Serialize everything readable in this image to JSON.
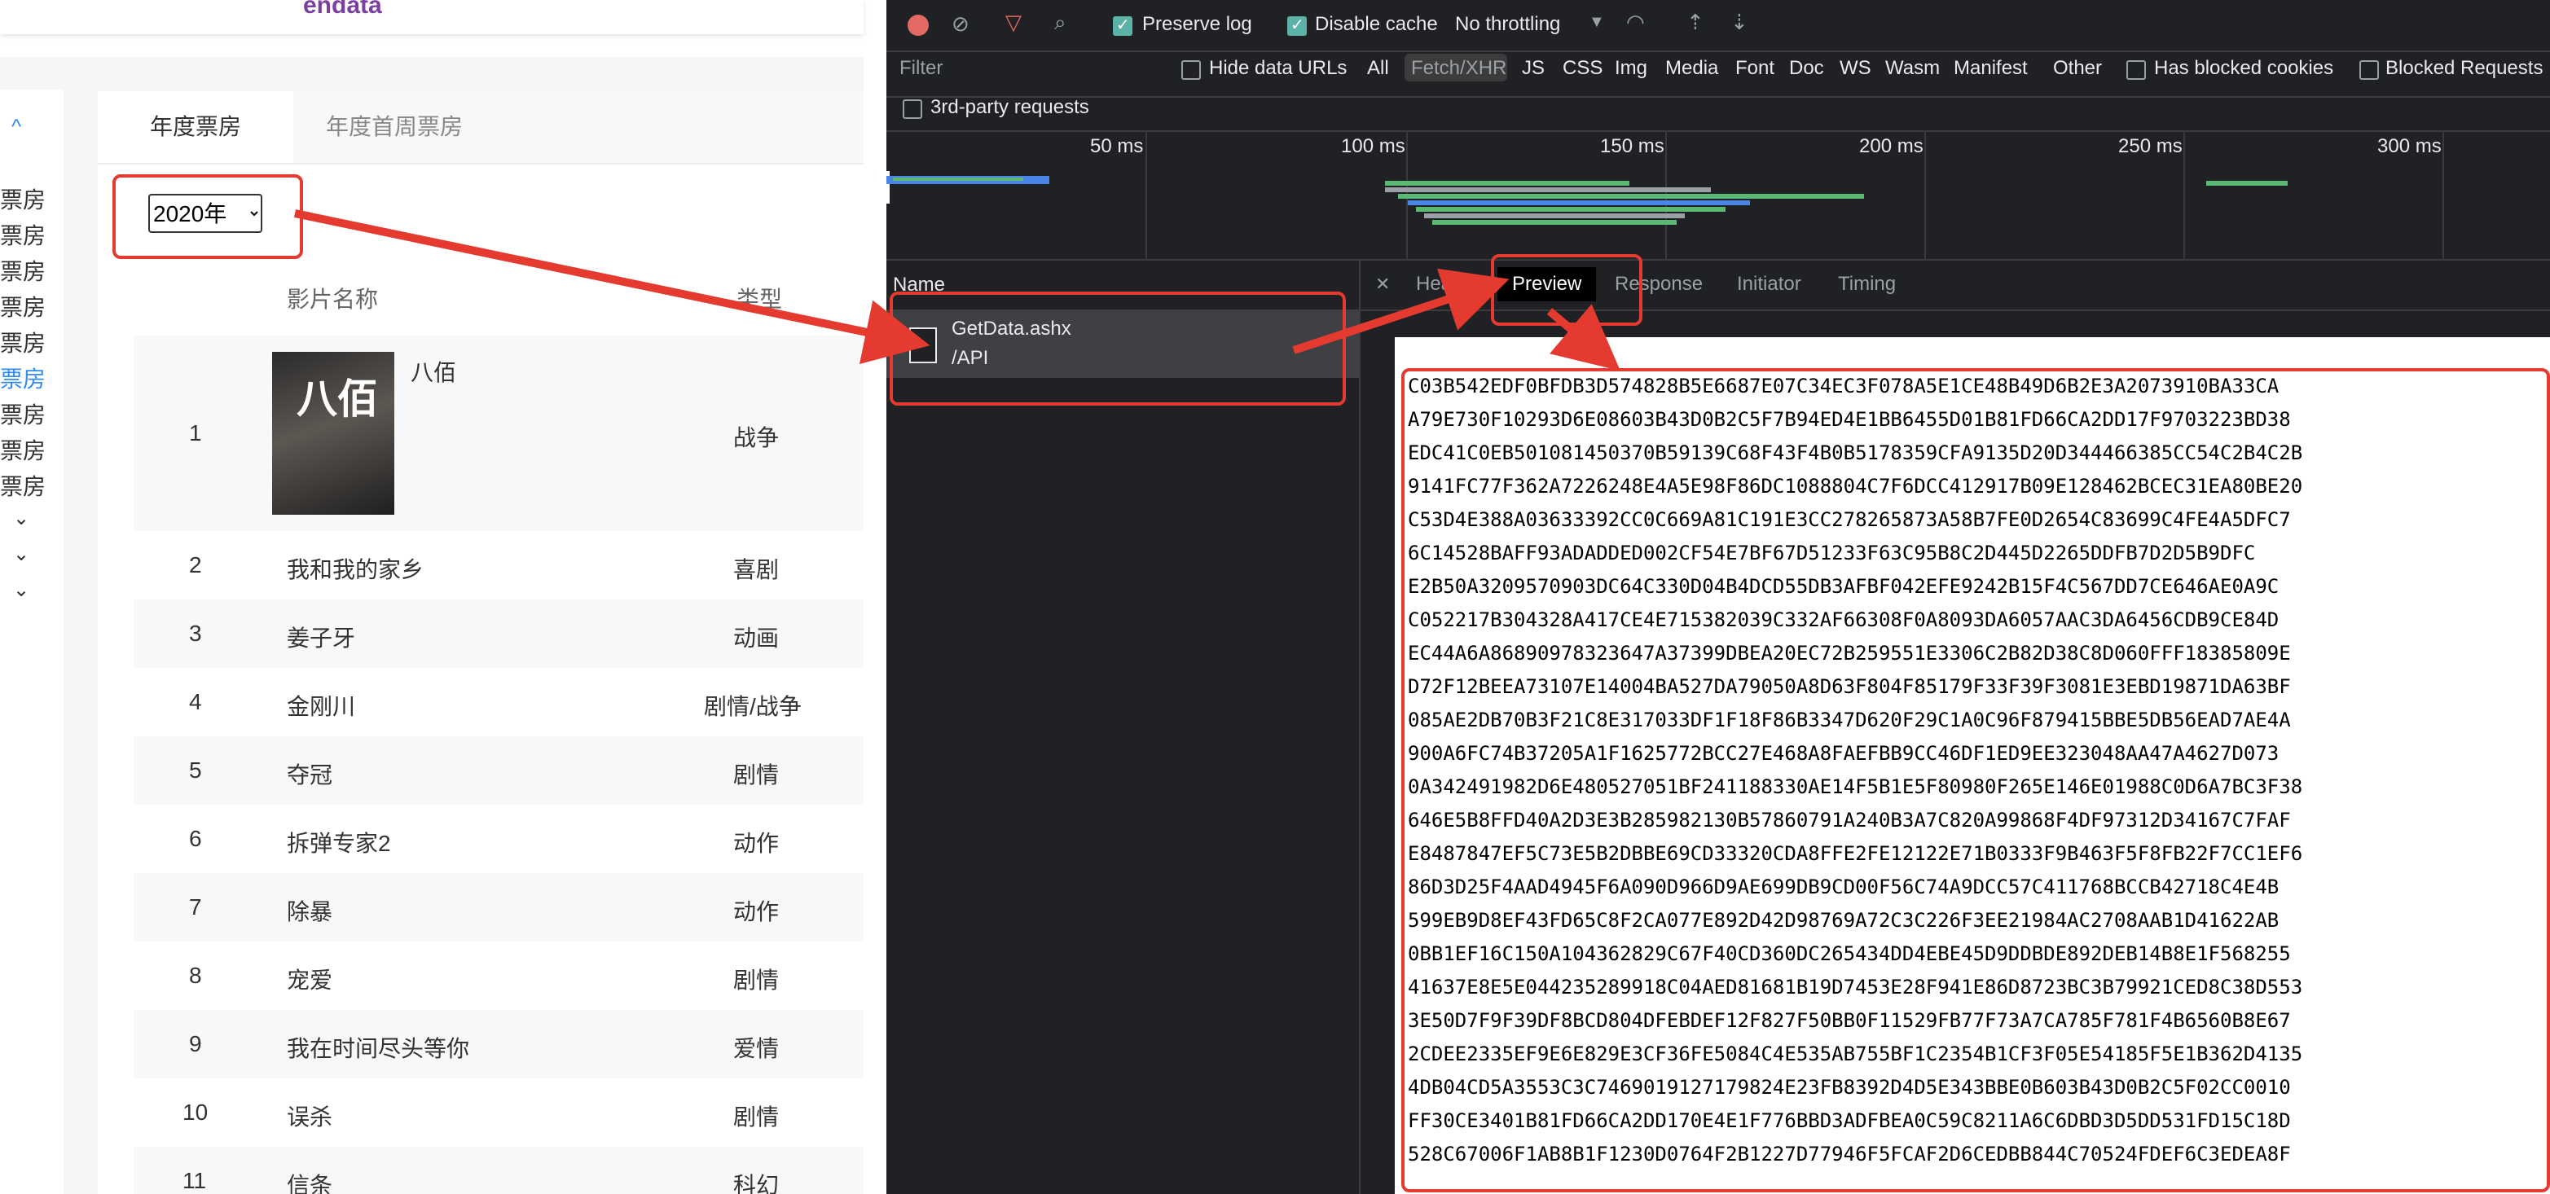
{
  "left": {
    "logo_text": "endata",
    "sidebar_items": [
      "票房",
      "票房",
      "票房",
      "票房",
      "票房",
      "票房",
      "票房",
      "票房",
      "票房"
    ],
    "active_index": 5,
    "tabs": [
      "年度票房",
      "年度首周票房"
    ],
    "year_select": {
      "value": "2020年",
      "options": [
        "2020年"
      ]
    },
    "table": {
      "headers": [
        "影片名称",
        "类型"
      ],
      "rows": [
        {
          "rank": "1",
          "title": "八佰",
          "genre": "战争",
          "poster_text": "八佰"
        },
        {
          "rank": "2",
          "title": "我和我的家乡",
          "genre": "喜剧"
        },
        {
          "rank": "3",
          "title": "姜子牙",
          "genre": "动画"
        },
        {
          "rank": "4",
          "title": "金刚川",
          "genre": "剧情/战争"
        },
        {
          "rank": "5",
          "title": "夺冠",
          "genre": "剧情"
        },
        {
          "rank": "6",
          "title": "拆弹专家2",
          "genre": "动作"
        },
        {
          "rank": "7",
          "title": "除暴",
          "genre": "动作"
        },
        {
          "rank": "8",
          "title": "宠爱",
          "genre": "剧情"
        },
        {
          "rank": "9",
          "title": "我在时间尽头等你",
          "genre": "爱情"
        },
        {
          "rank": "10",
          "title": "误杀",
          "genre": "剧情"
        },
        {
          "rank": "11",
          "title": "信条",
          "genre": "科幻"
        }
      ]
    }
  },
  "devtools": {
    "toolbar": {
      "preserve_log": "Preserve log",
      "disable_cache": "Disable cache",
      "throttling": "No throttling"
    },
    "filter": {
      "placeholder": "Filter",
      "hide_data_urls": "Hide data URLs",
      "types": [
        "All",
        "Fetch/XHR",
        "JS",
        "CSS",
        "Img",
        "Media",
        "Font",
        "Doc",
        "WS",
        "Wasm",
        "Manifest",
        "Other"
      ],
      "active_type": "Fetch/XHR",
      "has_blocked_cookies": "Has blocked cookies",
      "blocked_requests": "Blocked Requests",
      "third_party": "3rd-party requests"
    },
    "timeline_ticks": [
      "50 ms",
      "100 ms",
      "150 ms",
      "200 ms",
      "250 ms",
      "300 ms"
    ],
    "requests": {
      "column_name": "Name",
      "selected": {
        "name": "GetData.ashx",
        "path": "/API"
      }
    },
    "detail_tabs": [
      "Headers",
      "Preview",
      "Response",
      "Initiator",
      "Timing"
    ],
    "active_detail_tab": "Preview",
    "preview_lines": [
      "C03B542EDF0BFDB3D574828B5E6687E07C34EC3F078A5E1CE48B49D6B2E3A2073910BA33CA",
      "A79E730F10293D6E08603B43D0B2C5F7B94ED4E1BB6455D01B81FD66CA2DD17F9703223BD38",
      "EDC41C0EB501081450370B59139C68F43F4B0B5178359CFA9135D20D344466385CC54C2B4C2B",
      "9141FC77F362A7226248E4A5E98F86DC1088804C7F6DCC412917B09E128462BCEC31EA80BE20",
      "C53D4E388A03633392CC0C669A81C191E3CC278265873A58B7FE0D2654C83699C4FE4A5DFC7",
      "6C14528BAFF93ADADDED002CF54E7BF67D51233F63C95B8C2D445D2265DDFB7D2D5B9DFC",
      "E2B50A3209570903DC64C330D04B4DCD55DB3AFBF042EFE9242B15F4C567DD7CE646AE0A9C",
      "C052217B304328A417CE4E715382039C332AF66308F0A8093DA6057AAC3DA6456CDB9CE84D",
      "EC44A6A86890978323647A37399DBEA20EC72B259551E3306C2B82D38C8D060FFF18385809E",
      "D72F12BEEA73107E14004BA527DA79050A8D63F804F85179F33F39F3081E3EBD19871DA63BF",
      "085AE2DB70B3F21C8E317033DF1F18F86B3347D620F29C1A0C96F879415BBE5DB56EAD7AE4A",
      "900A6FC74B37205A1F1625772BCC27E468A8FAEFBB9CC46DF1ED9EE323048AA47A4627D073",
      "0A342491982D6E480527051BF241188330AE14F5B1E5F80980F265E146E01988C0D6A7BC3F38",
      "646E5B8FFD40A2D3E3B285982130B57860791A240B3A7C820A99868F4DF97312D34167C7FAF",
      "E8487847EF5C73E5B2DBBE69CD33320CDA8FFE2FE12122E71B0333F9B463F5F8FB22F7CC1EF6",
      "86D3D25F4AAD4945F6A090D966D9AE699DB9CD00F56C74A9DCC57C411768BCCB42718C4E4B",
      "599EB9D8EF43FD65C8F2CA077E892D42D98769A72C3C226F3EE21984AC2708AAB1D41622AB",
      "0BB1EF16C150A104362829C67F40CD360DC265434DD4EBE45D9DDBDE892DEB14B8E1F568255",
      "41637E8E5E044235289918C04AED81681B19D7453E28F941E86D8723BC3B79921CED8C38D553",
      "3E50D7F9F39DF8BCD804DFEBDEF12F827F50BB0F11529FB77F73A7CA785F781F4B6560B8E67",
      "2CDEE2335EF9E6E829E3CF36FE5084C4E535AB755BF1C2354B1CF3F05E54185F5E1B362D4135",
      "4DB04CD5A3553C3C7469019127179824E23FB8392D4D5E343BBE0B603B43D0B2C5F02CC0010",
      "FF30CE3401B81FD66CA2DD170E4E1F776BBD3ADFBEA0C59C8211A6C6DBD3D5DD531FD15C18D",
      "528C67006F1AB8B1F1230D0764F2B1227D77946F5FCAF2D6CEDBB844C70524FDEF6C3EDEA8F"
    ]
  }
}
